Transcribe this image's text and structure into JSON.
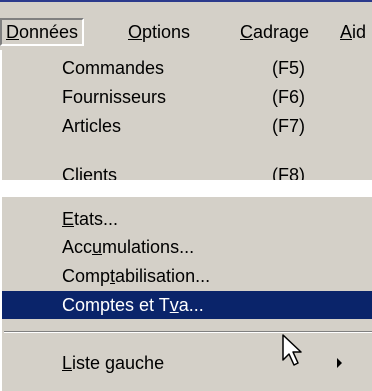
{
  "menubar": {
    "items": [
      {
        "pre": "",
        "key": "D",
        "post": "onnées"
      },
      {
        "pre": "",
        "key": "O",
        "post": "ptions"
      },
      {
        "pre": "",
        "key": "C",
        "post": "adrage"
      },
      {
        "pre": "",
        "key": "A",
        "post": "id"
      }
    ]
  },
  "top_menu": {
    "items": [
      {
        "label": "Commandes",
        "shortcut": "(F5)"
      },
      {
        "label": "Fournisseurs",
        "shortcut": "(F6)"
      },
      {
        "label": "Articles",
        "shortcut": "(F7)"
      },
      {
        "label": "Clients",
        "shortcut": "(F8)"
      }
    ]
  },
  "bottom_menu": {
    "items": [
      {
        "pre": "",
        "key": "E",
        "post": "tats..."
      },
      {
        "pre": "Acc",
        "key": "u",
        "post": "mulations..."
      },
      {
        "pre": "Comp",
        "key": "t",
        "post": "abilisation..."
      },
      {
        "pre": "Comptes et T",
        "key": "v",
        "post": "a..."
      },
      {
        "pre": "",
        "key": "L",
        "post": "iste gauche"
      }
    ]
  },
  "colors": {
    "menu_bg": "#d4d0c8",
    "highlight_bg": "#0a246a",
    "highlight_text": "#ffffff",
    "title_bar": "#2b3a8c"
  },
  "icons": {
    "submenu_arrow": "chevron-right-icon",
    "pointer": "mouse-cursor-icon"
  }
}
